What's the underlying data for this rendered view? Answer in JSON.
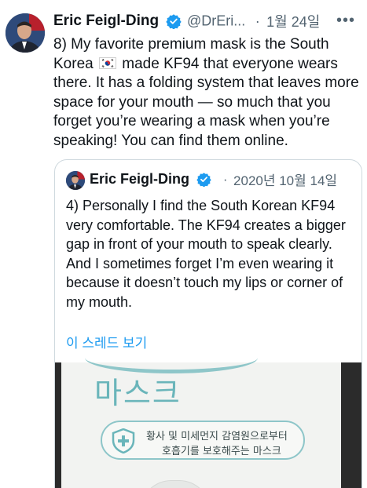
{
  "tweet": {
    "author_name": "Eric Feigl-Ding",
    "handle": "@DrEri...",
    "separator": "·",
    "timestamp": "1월 24일",
    "more_label": "•••",
    "text_part1": "8) My favorite premium mask is the South Korea ",
    "text_part2": " made KF94 that everyone wears there. It has a folding system that leaves more space for your mouth — so much that you forget you’re wearing a mask when you’re speaking! You can find them online.",
    "flag_icon": "south-korea-flag-icon"
  },
  "quoted_tweet": {
    "author_name": "Eric Feigl-Ding",
    "separator": "·",
    "timestamp": "2020년 10월 14일",
    "text": "4) Personally I find the South Korean KF94 very comfortable. The KF94 creates a bigger gap in front of your mouth to speak clearly. And I sometimes forget I’m even wearing it because it doesn’t touch my lips or corner of my mouth.",
    "show_thread_label": "이 스레드 보기",
    "image": {
      "product_title": "마스크",
      "badge_line1": "황사 및 미세먼지 감염원으로부터",
      "badge_line2": "호흡기를 보호해주는 마스크"
    }
  },
  "colors": {
    "link": "#1d9bf0",
    "verified": "#1d9bf0",
    "muted": "#536471",
    "text": "#0f1419",
    "mask_accent": "#6ab5ba"
  }
}
